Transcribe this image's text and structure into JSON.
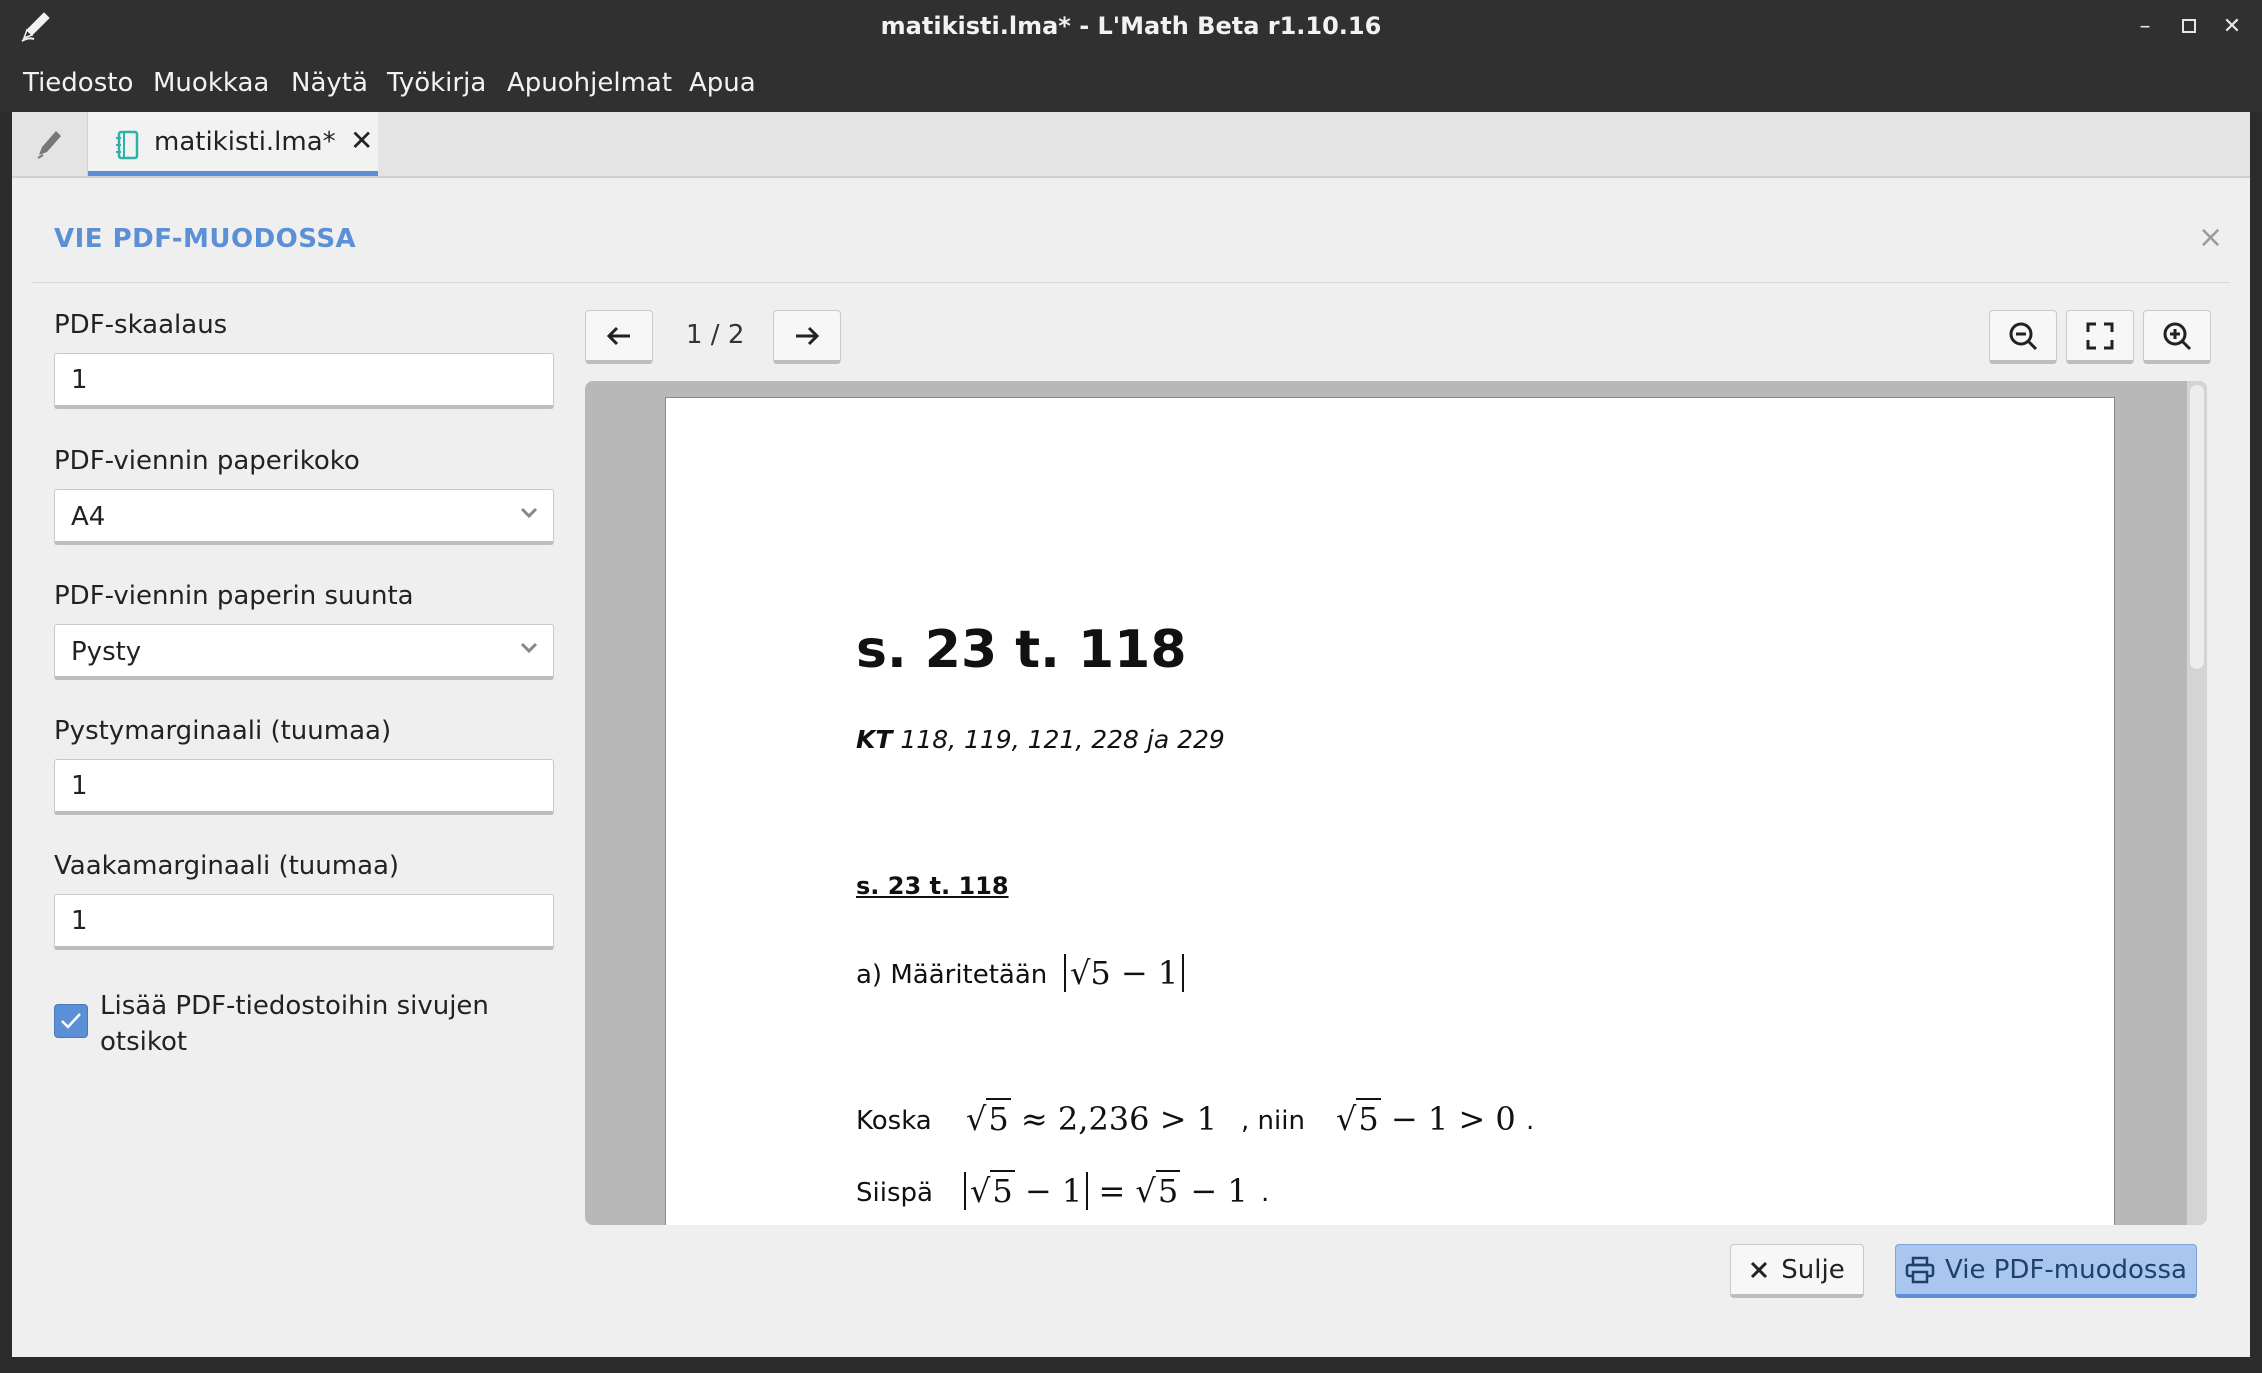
{
  "window": {
    "title": "matikisti.lma* - L'Math Beta r1.10.16",
    "controls": [
      "minimize-icon",
      "maximize-icon",
      "close-icon"
    ]
  },
  "menu": {
    "items": [
      {
        "label": "Tiedosto"
      },
      {
        "label": "Muokkaa"
      },
      {
        "label": "Näytä"
      },
      {
        "label": "Työkirja"
      },
      {
        "label": "Apuohjelmat"
      },
      {
        "label": "Apua"
      }
    ]
  },
  "tabs": {
    "document": {
      "label": "matikisti.lma*",
      "close": "✕"
    }
  },
  "dialog": {
    "title": "VIE PDF-MUODOSSA",
    "close_symbol": "×",
    "fields": {
      "scale": {
        "label": "PDF-skaalaus",
        "value": "1"
      },
      "paper_size": {
        "label": "PDF-viennin paperikoko",
        "value": "A4"
      },
      "orientation": {
        "label": "PDF-viennin paperin suunta",
        "value": "Pysty"
      },
      "vertical_margin": {
        "label": "Pystymarginaali (tuumaa)",
        "value": "1"
      },
      "horizontal_margin": {
        "label": "Vaakamarginaali (tuumaa)",
        "value": "1"
      }
    },
    "checkbox": {
      "label": "Lisää PDF-tiedostoihin sivujen otsikot",
      "checked": true
    }
  },
  "preview": {
    "page_indicator": "1 / 2",
    "current_page": 1,
    "total_pages": 2,
    "content": {
      "heading": "s. 23 t. 118",
      "kt_bold": "KT",
      "kt_rest": " 118, 119, 121, 228 ja 229",
      "subheading": "s. 23 t. 118",
      "line_a_text": "a) Määritetään",
      "line_a_math": "5 − 1",
      "koska_text": "Koska",
      "koska_math": "≈ 2,236  >  1",
      "niin_text": ", niin",
      "niin_math": "− 1 > 0",
      "period": ".",
      "siispa_text": "Siispä",
      "siispa_math_left": "− 1",
      "siispa_math_eq": "=",
      "siispa_math_right": "− 1",
      "radicand": "5"
    }
  },
  "buttons": {
    "close_label": "Sulje",
    "export_label": "Vie PDF-muodossa"
  },
  "colors": {
    "accent": "#5b8fd6",
    "titlebar": "#303030",
    "background": "#efefef"
  }
}
